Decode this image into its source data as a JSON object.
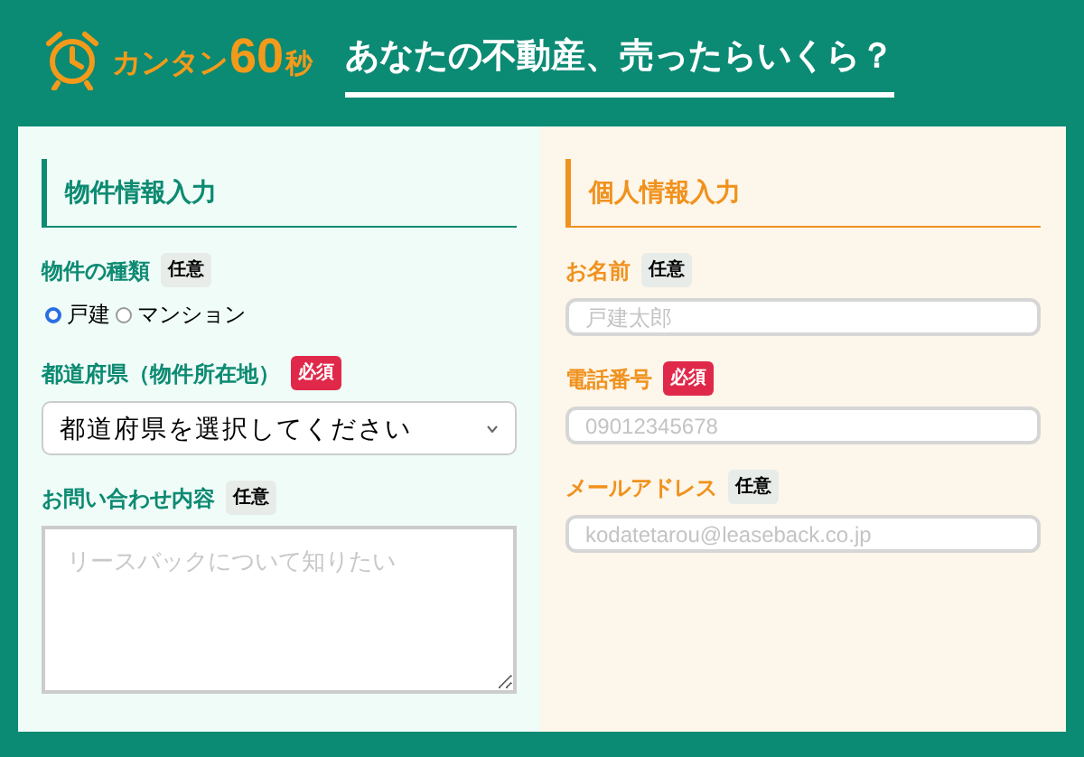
{
  "header": {
    "logo": {
      "prefix": "カンタン",
      "number": "60",
      "unit": "秒"
    },
    "headline": "あなたの不動産、売ったらいくら？"
  },
  "sections": [
    {
      "title": "物件情報入力",
      "color": "#0d8a72",
      "fields": [
        {
          "kind": "radio",
          "label": "物件の種類",
          "badge": {
            "text": "任意",
            "required": false
          },
          "options": [
            {
              "label": "戸建",
              "selected": true
            },
            {
              "label": "マンション",
              "selected": false
            }
          ]
        },
        {
          "kind": "select",
          "label": "都道府県（物件所在地）",
          "badge": {
            "text": "必須",
            "required": true
          },
          "value": "都道府県を選択してください"
        },
        {
          "kind": "textarea",
          "label": "お問い合わせ内容",
          "badge": {
            "text": "任意",
            "required": false
          },
          "placeholder": "リースバックについて知りたい"
        }
      ]
    },
    {
      "title": "個人情報入力",
      "color": "#f0921e",
      "fields": [
        {
          "kind": "text",
          "label": "お名前",
          "badge": {
            "text": "任意",
            "required": false
          },
          "placeholder": "戸建太郎"
        },
        {
          "kind": "text",
          "label": "電話番号",
          "badge": {
            "text": "必須",
            "required": true
          },
          "placeholder": "09012345678"
        },
        {
          "kind": "text",
          "label": "メールアドレス",
          "badge": {
            "text": "任意",
            "required": false
          },
          "placeholder": "kodatetarou@leaseback.co.jp"
        }
      ]
    }
  ]
}
